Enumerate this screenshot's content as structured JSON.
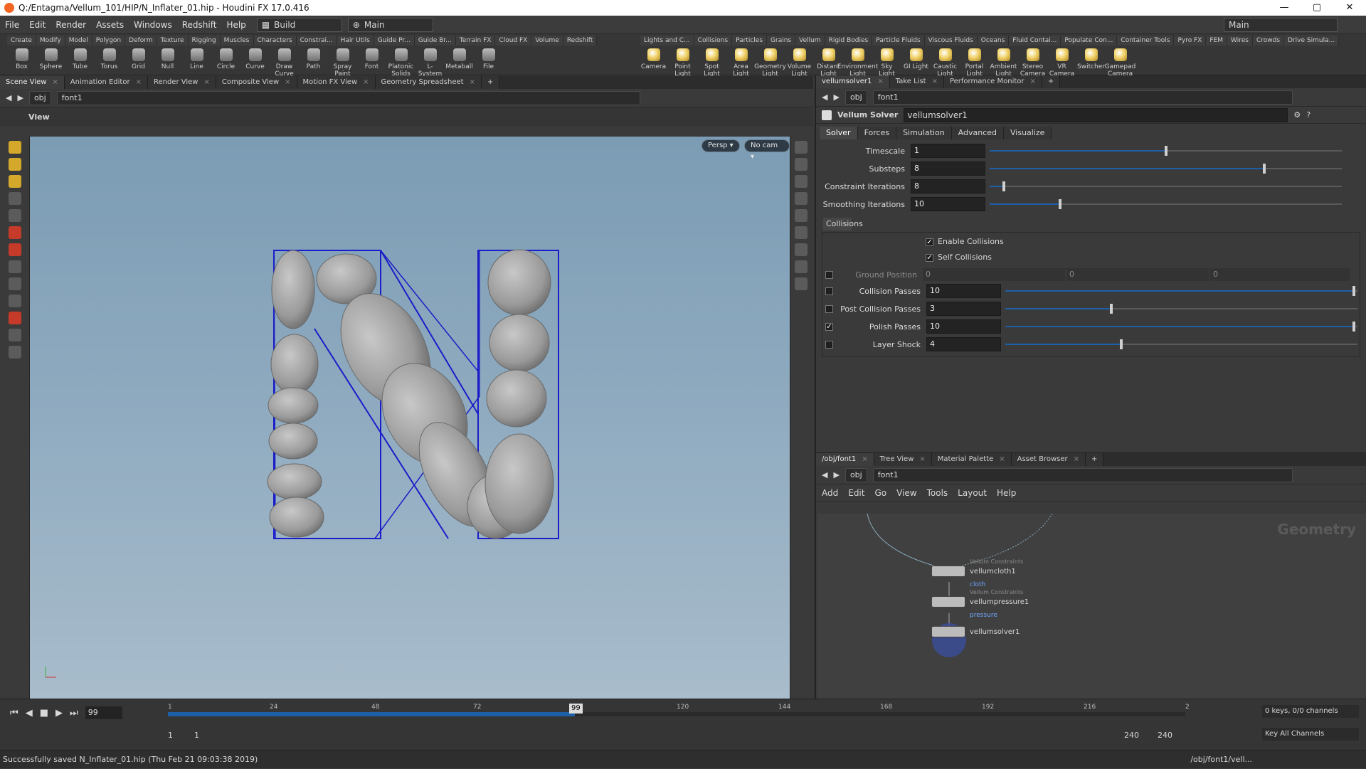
{
  "window": {
    "title": "Q:/Entagma/Vellum_101/HIP/N_Inflater_01.hip - Houdini FX 17.0.416",
    "minimize": "—",
    "maximize": "▢",
    "close": "✕"
  },
  "menu": {
    "items": [
      "File",
      "Edit",
      "Render",
      "Assets",
      "Windows",
      "Redshift",
      "Help"
    ],
    "desktop": "Build",
    "desktop_main": "Main",
    "right_desktop": "Main"
  },
  "shelf_left": {
    "tabs": [
      "Create",
      "Modify",
      "Model",
      "Polygon",
      "Deform",
      "Texture",
      "Rigging",
      "Muscles",
      "Characters",
      "Constrai...",
      "Hair Utils",
      "Guide Pr...",
      "Guide Br...",
      "Terrain FX",
      "Cloud FX",
      "Volume",
      "Redshift"
    ],
    "tools": [
      "Box",
      "Sphere",
      "Tube",
      "Torus",
      "Grid",
      "Null",
      "Line",
      "Circle",
      "Curve",
      "Draw Curve",
      "Path",
      "Spray Paint",
      "Font",
      "Platonic Solids",
      "L-System",
      "Metaball",
      "File"
    ]
  },
  "shelf_right": {
    "tabs": [
      "Lights and C...",
      "Collisions",
      "Particles",
      "Grains",
      "Vellum",
      "Rigid Bodies",
      "Particle Fluids",
      "Viscous Fluids",
      "Oceans",
      "Fluid Contai...",
      "Populate Con...",
      "Container Tools",
      "Pyro FX",
      "FEM",
      "Wires",
      "Crowds",
      "Drive Simula..."
    ],
    "tools": [
      "Camera",
      "Point Light",
      "Spot Light",
      "Area Light",
      "Geometry Light",
      "Volume Light",
      "Distant Light",
      "Environment Light",
      "Sky Light",
      "GI Light",
      "Caustic Light",
      "Portal Light",
      "Ambient Light",
      "Stereo Camera",
      "VR Camera",
      "Switcher",
      "Gamepad Camera"
    ]
  },
  "scene_tabs": [
    "Scene View",
    "Animation Editor",
    "Render View",
    "Composite View",
    "Motion FX View",
    "Geometry Spreadsheet"
  ],
  "scene_path": {
    "root": "obj",
    "node": "font1"
  },
  "viewport": {
    "label": "View",
    "persp": "Persp ▾",
    "cam": "No cam ▾"
  },
  "param_tabs_pane": [
    "vellumsolver1",
    "Take List",
    "Performance Monitor"
  ],
  "param_path": {
    "root": "obj",
    "node": "font1"
  },
  "node_header": {
    "type": "Vellum Solver",
    "name": "vellumsolver1"
  },
  "param_tabs": [
    "Solver",
    "Forces",
    "Simulation",
    "Advanced",
    "Visualize"
  ],
  "params_top": [
    {
      "label": "Timescale",
      "value": "1",
      "frac": 0.5
    },
    {
      "label": "Substeps",
      "value": "8",
      "frac": 0.78
    },
    {
      "label": "Constraint Iterations",
      "value": "8",
      "frac": 0.04
    },
    {
      "label": "Smoothing Iterations",
      "value": "10",
      "frac": 0.2
    }
  ],
  "collisions": {
    "folder": "Collisions",
    "enable": "Enable Collisions",
    "self": "Self Collisions",
    "ground_label": "Ground Position",
    "ground_values": [
      "0",
      "0",
      "0"
    ],
    "params": [
      {
        "label": "Collision Passes",
        "value": "10",
        "frac": 0.99,
        "checked": false
      },
      {
        "label": "Post Collision Passes",
        "value": "3",
        "frac": 0.3,
        "checked": false
      },
      {
        "label": "Polish Passes",
        "value": "10",
        "frac": 0.99,
        "checked": true
      },
      {
        "label": "Layer Shock",
        "value": "4",
        "frac": 0.33,
        "checked": false
      }
    ]
  },
  "net_tabs": [
    "/obj/font1",
    "Tree View",
    "Material Palette",
    "Asset Browser"
  ],
  "net_path": {
    "root": "obj",
    "node": "font1"
  },
  "net_menu": [
    "Add",
    "Edit",
    "Go",
    "View",
    "Tools",
    "Layout",
    "Help"
  ],
  "net_watermark": "Geometry",
  "nodes": [
    {
      "type": "Vellum Constraints",
      "name": "vellumcloth1",
      "sub": "cloth"
    },
    {
      "type": "Vellum Constraints",
      "name": "vellumpressure1",
      "sub": "pressure"
    },
    {
      "type": "",
      "name": "vellumsolver1",
      "sub": ""
    }
  ],
  "timeline": {
    "frame": "99",
    "ticks": [
      "1",
      "24",
      "48",
      "72",
      "96",
      "120",
      "144",
      "168",
      "192",
      "216",
      "2"
    ],
    "current_marker": "99",
    "start": "1",
    "start2": "1",
    "end": "240",
    "end2": "240",
    "keys": "0 keys, 0/0 channels",
    "key_all": "Key All Channels",
    "progress": 0.4
  },
  "status": {
    "message": "Successfully saved N_Inflater_01.hip (Thu Feb 21 09:03:38 2019)",
    "path": "/obj/font1/vell..."
  },
  "colors": {
    "accent": "#1f5fa8",
    "viewport_top": "#7b9cb4",
    "viewport_bottom": "#a8bccb",
    "bbox": "#1c1cc8"
  }
}
